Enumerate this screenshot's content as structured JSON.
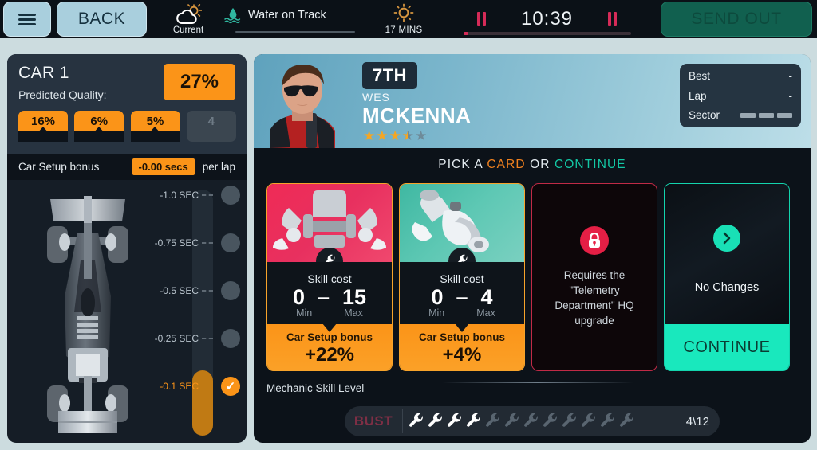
{
  "topbar": {
    "menu_icon": "hamburger-icon",
    "back_label": "BACK",
    "weather_current_icon": "sun-behind-cloud-icon",
    "weather_current_label": "Current",
    "track_state_icon": "water-droplet-waves-icon",
    "track_state_label": "Water on Track",
    "weather_next_icon": "sun-icon",
    "weather_next_label": "17 MINS",
    "pause_icon": "pause-icon",
    "timer": "10:39",
    "send_out_label": "SEND OUT"
  },
  "left_panel": {
    "car_title": "CAR 1",
    "predicted_quality_label": "Predicted Quality:",
    "predicted_quality_value": "27%",
    "tyres": [
      {
        "value": "16%",
        "empty": false
      },
      {
        "value": "6%",
        "empty": false
      },
      {
        "value": "5%",
        "empty": false
      },
      {
        "value": "4",
        "empty": true
      }
    ],
    "setup_bonus_label": "Car Setup bonus",
    "setup_bonus_value": "-0.00 secs",
    "setup_bonus_suffix": "per lap",
    "car_image_name": "f1-car-top-view",
    "scale": [
      {
        "label": "-1.0 SEC",
        "active": false
      },
      {
        "label": "-0.75 SEC",
        "active": false
      },
      {
        "label": "-0.5 SEC",
        "active": false
      },
      {
        "label": "-0.25 SEC",
        "active": false
      },
      {
        "label": "-0.1 SEC",
        "active": true,
        "check": "✓"
      }
    ]
  },
  "main_panel": {
    "driver": {
      "position": "7TH",
      "first_name": "WES",
      "last_name": "MCKENNA",
      "rating": 3.5,
      "rating_max": 5
    },
    "timing": {
      "best_label": "Best",
      "best_value": "-",
      "lap_label": "Lap",
      "lap_value": "-",
      "sector_label": "Sector",
      "sector_segments": 3
    },
    "pick_title": {
      "prefix": "PICK A ",
      "card_word": "CARD",
      "middle": " OR ",
      "continue_word": "CONTINUE"
    },
    "cards": [
      {
        "type": "part",
        "art_name": "brake-assembly-art",
        "badge_icon": "wrench-icon",
        "skill_cost_label": "Skill cost",
        "min": "0",
        "dash": "–",
        "max": "15",
        "min_label": "Min",
        "max_label": "Max",
        "bonus_label": "Car Setup bonus",
        "bonus_value": "+22%"
      },
      {
        "type": "part",
        "art_name": "exhaust-part-art",
        "badge_icon": "wrench-icon",
        "skill_cost_label": "Skill cost",
        "min": "0",
        "dash": "–",
        "max": "4",
        "min_label": "Min",
        "max_label": "Max",
        "bonus_label": "Car Setup bonus",
        "bonus_value": "+4%"
      },
      {
        "type": "locked",
        "lock_icon": "padlock-icon",
        "text": "Requires the \"Telemetry Department\" HQ upgrade"
      },
      {
        "type": "continue",
        "arrow_icon": "chevron-right-icon",
        "label": "No Changes",
        "button_label": "CONTINUE"
      }
    ],
    "mechanic": {
      "label": "Mechanic Skill Level",
      "bust_label": "BUST",
      "total": 12,
      "filled": 4,
      "count_text": "4\\12",
      "wrench_icon": "wrench-icon"
    }
  },
  "colors": {
    "accent_orange": "#fb9418",
    "accent_teal": "#19e8bd",
    "accent_red": "#e51f45",
    "panel_dark": "#0c1219",
    "page_bg": "#ccdcdf",
    "header_bg": "#0b1117",
    "button_blue": "#a9cfdd",
    "send_out_green": "#11604f",
    "star_gold": "#f5a623"
  }
}
